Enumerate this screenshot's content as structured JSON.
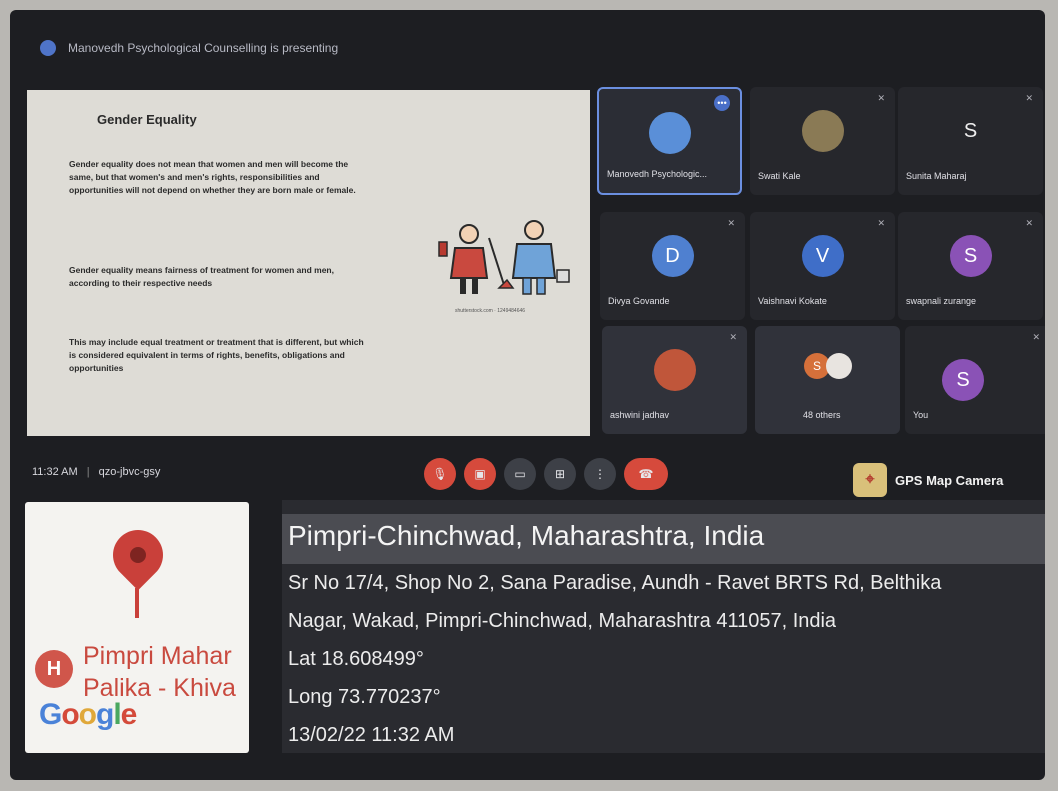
{
  "meeting": {
    "presenting_text": "Manovedh Psychological Counselling is presenting",
    "time": "11:32 AM",
    "separator": "|",
    "code": "qzo-jbvc-gsy"
  },
  "slide": {
    "title": "Gender Equality",
    "paragraphs": [
      "Gender equality does not mean that women and men will become the same, but that women's and men's rights, responsibilities and opportunities will not depend on whether they are born male or female.",
      "Gender equality means fairness of treatment for women and men, according to their respective needs",
      "This may include equal treatment or treatment that is different, but which is considered equivalent in terms of rights, benefits, obligations and opportunities"
    ],
    "image_caption": "shutterstock.com · 1249484646"
  },
  "participants": [
    {
      "name": "Manovedh Psychologic...",
      "initial": "",
      "color": "#5a8fd8",
      "muted": false
    },
    {
      "name": "Swati Kale",
      "initial": "",
      "color": "#8a7a55",
      "muted": true
    },
    {
      "name": "Sunita Maharaj",
      "initial": "S",
      "color": "",
      "muted": true
    },
    {
      "name": "Divya Govande",
      "initial": "D",
      "color": "#4f80d0",
      "muted": true
    },
    {
      "name": "Vaishnavi Kokate",
      "initial": "V",
      "color": "#3f6ec8",
      "muted": true
    },
    {
      "name": "swapnali zurange",
      "initial": "S",
      "color": "#8a52b6",
      "muted": true
    },
    {
      "name": "ashwini jadhav",
      "initial": "",
      "color": "#c0563a",
      "muted": true
    },
    {
      "name": "48 others",
      "initial": "S",
      "color": "#d5703a",
      "muted": false
    },
    {
      "name": "You",
      "initial": "S",
      "color": "#8a52b6",
      "muted": true
    }
  ],
  "controls": [
    "mic-off",
    "camera-off",
    "captions",
    "present",
    "more",
    "end-call"
  ],
  "gps": {
    "app_label": "GPS Map Camera",
    "title": "Pimpri-Chinchwad, Maharashtra, India",
    "address_line1": "Sr No 17/4, Shop No 2, Sana Paradise, Aundh - Ravet BRTS Rd, Belthika",
    "address_line2": "Nagar, Wakad, Pimpri-Chinchwad, Maharashtra 411057, India",
    "lat": "Lat 18.608499°",
    "long": "Long 73.770237°",
    "datetime": "13/02/22 11:32 AM",
    "map_text1": "Pimpri Mahar",
    "map_text2": "Palika - Khiva",
    "map_badge": "H",
    "google_logo": "Google"
  }
}
